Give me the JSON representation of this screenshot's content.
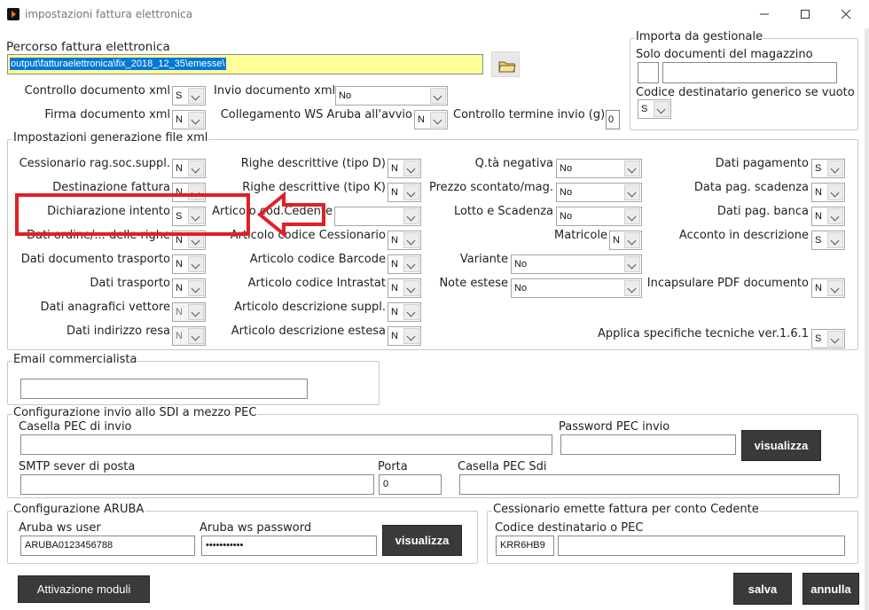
{
  "window": {
    "title": "impostazioni fattura elettronica"
  },
  "percorso": {
    "label": "Percorso fattura elettronica",
    "value": "output\\fatturaelettronica\\fix_2018_12_35\\emesse\\"
  },
  "top": {
    "controllo_xml": {
      "label": "Controllo documento xml",
      "value": "S"
    },
    "firma_xml": {
      "label": "Firma documento xml",
      "value": "N"
    },
    "invio_xml": {
      "label": "Invio documento xml",
      "value": "No"
    },
    "collegamento_ws": {
      "label": "Collegamento WS Aruba all'avvio",
      "value": "N"
    },
    "controllo_termine": {
      "label": "Controllo termine invio (g)",
      "value": "0"
    }
  },
  "importa": {
    "title": "Importa da gestionale",
    "solo_label": "Solo documenti del magazzino",
    "codice_label": "Codice destinatario generico se vuoto",
    "codice_value": "S"
  },
  "gen": {
    "title": "Impostazioni generazione file xml",
    "col1": [
      {
        "label": "Cessionario rag.soc.suppl.",
        "value": "N"
      },
      {
        "label": "Destinazione fattura",
        "value": "N"
      },
      {
        "label": "Dichiarazione intento",
        "value": "S"
      },
      {
        "label": "Dati ordine/... delle righe",
        "value": "N"
      },
      {
        "label": "Dati documento trasporto",
        "value": "N"
      },
      {
        "label": "Dati trasporto",
        "value": "N"
      },
      {
        "label": "Dati anagrafici vettore",
        "value": "N"
      },
      {
        "label": "Dati indirizzo resa",
        "value": "N"
      }
    ],
    "col2": [
      {
        "label": "Righe descrittive (tipo D)",
        "value": "N"
      },
      {
        "label": "Righe descrittive (tipo K)",
        "value": "N"
      },
      {
        "label": "Articolo cod.Cedente",
        "value": ""
      },
      {
        "label": "Articolo codice Cessionario",
        "value": "N"
      },
      {
        "label": "Articolo codice Barcode",
        "value": "N"
      },
      {
        "label": "Articolo codice Intrastat",
        "value": "N"
      },
      {
        "label": "Articolo descrizione suppl.",
        "value": "N"
      },
      {
        "label": "Articolo descrizione estesa",
        "value": "N"
      }
    ],
    "col3": [
      {
        "label": "Q.tà negativa",
        "value": "No"
      },
      {
        "label": "Prezzo scontato/mag.",
        "value": "No"
      },
      {
        "label": "Lotto e Scadenza",
        "value": "No"
      },
      {
        "label": "Matricole",
        "value": "N"
      },
      {
        "label": "Variante",
        "value": "No"
      },
      {
        "label": "Note estese",
        "value": "No"
      }
    ],
    "col4": [
      {
        "label": "Dati pagamento",
        "value": "S"
      },
      {
        "label": "Data pag. scadenza",
        "value": "N"
      },
      {
        "label": "Dati pag. banca",
        "value": "N"
      },
      {
        "label": "Acconto in descrizione",
        "value": "S"
      },
      {
        "label": "Incapsulare PDF documento",
        "value": "N"
      },
      {
        "label": "Applica specifiche tecniche ver.1.6.1",
        "value": "S"
      }
    ]
  },
  "email": {
    "title": "Email commercialista",
    "value": ""
  },
  "pec": {
    "title": "Configurazione invio allo SDI a mezzo PEC",
    "casella_label": "Casella PEC di invio",
    "password_label": "Password PEC invio",
    "visualizza": "visualizza",
    "smtp_label": "SMTP sever di posta",
    "porta_label": "Porta",
    "porta_value": "0",
    "sdi_label": "Casella PEC Sdi"
  },
  "aruba": {
    "title": "Configurazione ARUBA",
    "user_label": "Aruba ws user",
    "user_value": "ARUBA0123456788",
    "pwd_label": "Aruba ws password",
    "pwd_value": "•••••••••••",
    "visualizza": "visualizza"
  },
  "cess": {
    "title": "Cessionario emette fattura per conto Cedente",
    "codice_label": "Codice destinatario o PEC",
    "codice_value": "KRR6HB9",
    "pec_value": ""
  },
  "buttons": {
    "attivazione": "Attivazione moduli",
    "salva": "salva",
    "annulla": "annulla"
  },
  "colors": {
    "highlight": "#e01f26",
    "path_bg": "#ffff99",
    "path_sel": "#0078d7",
    "button": "#3a3a3a"
  }
}
